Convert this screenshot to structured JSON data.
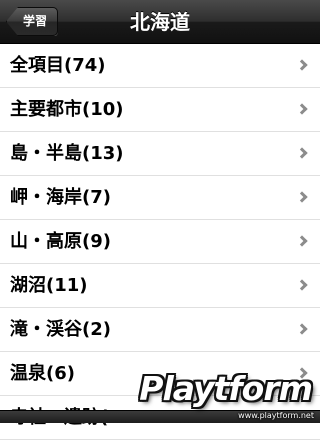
{
  "navbar": {
    "back_label": "学習",
    "title": "北海道"
  },
  "list": {
    "items": [
      {
        "label": "全項目(74)"
      },
      {
        "label": "主要都市(10)"
      },
      {
        "label": "島・半島(13)"
      },
      {
        "label": "岬・海岸(7)"
      },
      {
        "label": "山・高原(9)"
      },
      {
        "label": "湖沼(11)"
      },
      {
        "label": "滝・渓谷(2)"
      },
      {
        "label": "温泉(6)"
      },
      {
        "label": "寺社・遺跡(…"
      }
    ]
  },
  "watermark": {
    "brand": "Playtform",
    "url": "www.playtform.net"
  },
  "colors": {
    "navbar": "#1a1a1a",
    "chevron": "#8c8c8c",
    "separator": "#e0e0e0"
  }
}
